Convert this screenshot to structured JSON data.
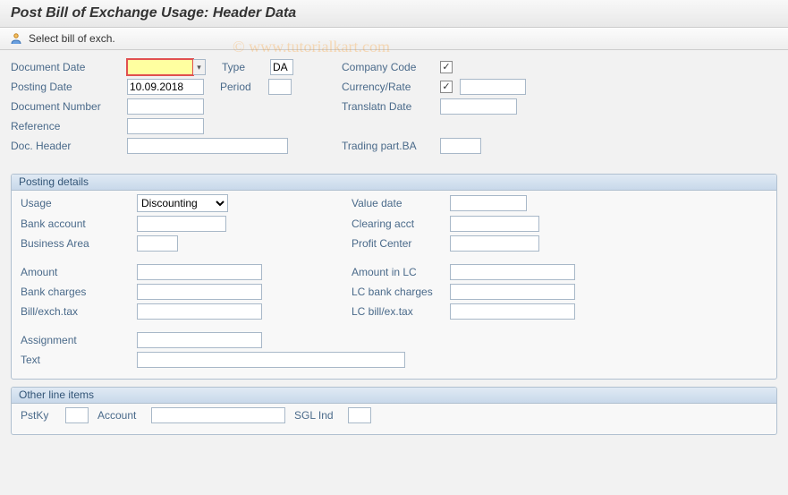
{
  "title": "Post Bill of Exchange Usage: Header Data",
  "toolbar": {
    "select_label": "Select bill of exch."
  },
  "watermark": "© www.tutorialkart.com",
  "header": {
    "document_date_label": "Document Date",
    "document_date": "",
    "type_label": "Type",
    "type": "DA",
    "company_code_label": "Company Code",
    "company_code_checked": "✓",
    "company_code": "",
    "posting_date_label": "Posting Date",
    "posting_date": "10.09.2018",
    "period_label": "Period",
    "period": "",
    "currency_rate_label": "Currency/Rate",
    "currency_checked": "✓",
    "currency": "",
    "rate": "",
    "document_number_label": "Document Number",
    "document_number": "",
    "translatn_date_label": "Translatn Date",
    "translatn_date": "",
    "reference_label": "Reference",
    "reference": "",
    "doc_header_label": "Doc. Header",
    "doc_header": "",
    "trading_part_ba_label": "Trading part.BA",
    "trading_part_ba": ""
  },
  "posting": {
    "legend": "Posting details",
    "usage_label": "Usage",
    "usage_value": "Discounting",
    "value_date_label": "Value date",
    "value_date": "",
    "bank_account_label": "Bank account",
    "bank_account": "",
    "clearing_acct_label": "Clearing acct",
    "clearing_acct": "",
    "business_area_label": "Business Area",
    "business_area": "",
    "profit_center_label": "Profit Center",
    "profit_center": "",
    "amount_label": "Amount",
    "amount": "",
    "amount_in_lc_label": "Amount in LC",
    "amount_in_lc": "",
    "bank_charges_label": "Bank charges",
    "bank_charges": "",
    "lc_bank_charges_label": "LC bank charges",
    "lc_bank_charges": "",
    "bill_exch_tax_label": "Bill/exch.tax",
    "bill_exch_tax": "",
    "lc_bill_ex_tax_label": "LC bill/ex.tax",
    "lc_bill_ex_tax": "",
    "assignment_label": "Assignment",
    "assignment": "",
    "text_label": "Text",
    "text": ""
  },
  "other": {
    "legend": "Other line items",
    "pstky_label": "PstKy",
    "pstky": "",
    "account_label": "Account",
    "account": "",
    "sgl_ind_label": "SGL Ind",
    "sgl_ind": ""
  }
}
